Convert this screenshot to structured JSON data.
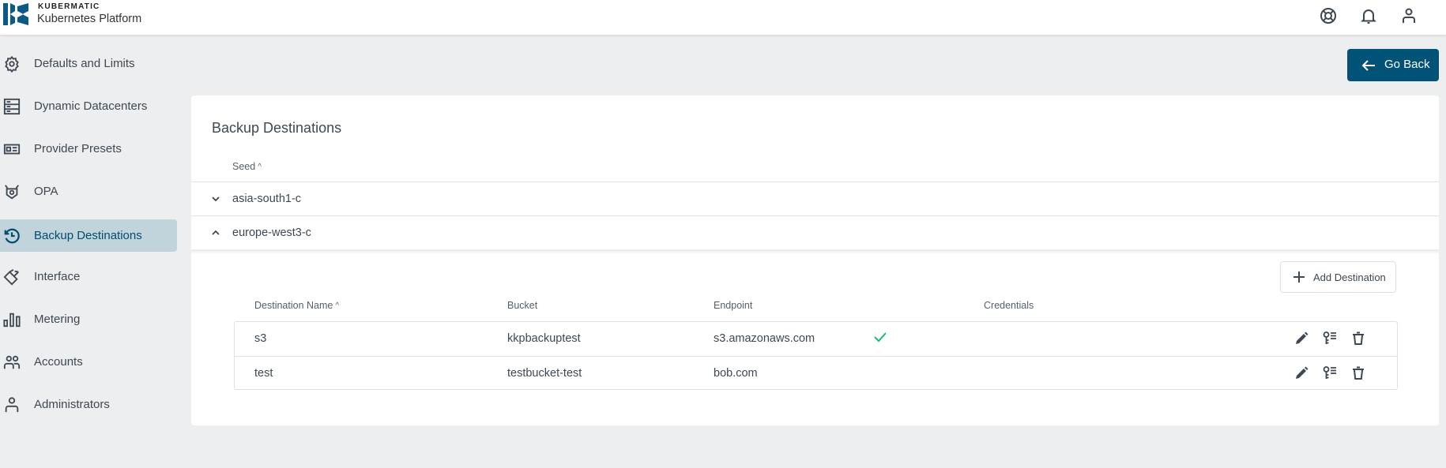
{
  "app": {
    "brand": "KUBERMATIC",
    "product": "Kubernetes Platform"
  },
  "topbar_icons": [
    "help-lifebuoy-icon",
    "notifications-bell-icon",
    "account-user-icon"
  ],
  "sidebar": {
    "items": [
      {
        "label": "Defaults and Limits",
        "icon": "gear-icon",
        "active": false
      },
      {
        "label": "Dynamic Datacenters",
        "icon": "datacenter-icon",
        "active": false
      },
      {
        "label": "Provider Presets",
        "icon": "preset-card-icon",
        "active": false
      },
      {
        "label": "OPA",
        "icon": "opa-icon",
        "active": false
      },
      {
        "label": "Backup Destinations",
        "icon": "history-icon",
        "active": true
      },
      {
        "label": "Interface",
        "icon": "interface-icon",
        "active": false
      },
      {
        "label": "Metering",
        "icon": "bar-chart-icon",
        "active": false
      },
      {
        "label": "Accounts",
        "icon": "accounts-icon",
        "active": false
      },
      {
        "label": "Administrators",
        "icon": "admin-user-icon",
        "active": false
      }
    ]
  },
  "header": {
    "go_back_label": "Go Back"
  },
  "main": {
    "title": "Backup Destinations",
    "seed_column": "Seed",
    "seeds": [
      {
        "name": "asia-south1-c",
        "expanded": false
      },
      {
        "name": "europe-west3-c",
        "expanded": true
      }
    ],
    "add_destination_label": "Add Destination",
    "destinations_table": {
      "columns": [
        "Destination Name",
        "Bucket",
        "Endpoint",
        "Credentials"
      ],
      "sorted_by": "Destination Name",
      "rows": [
        {
          "name": "s3",
          "bucket": "kkpbackuptest",
          "endpoint": "s3.amazonaws.com",
          "credentials": true
        },
        {
          "name": "test",
          "bucket": "testbucket-test",
          "endpoint": "bob.com",
          "credentials": false
        }
      ],
      "row_actions": [
        "edit",
        "edit-credentials",
        "delete"
      ]
    }
  },
  "colors": {
    "primary": "#005377",
    "active_nav_bg": "#c1d4dc",
    "background": "#eceef0",
    "success": "#1bb97a"
  }
}
